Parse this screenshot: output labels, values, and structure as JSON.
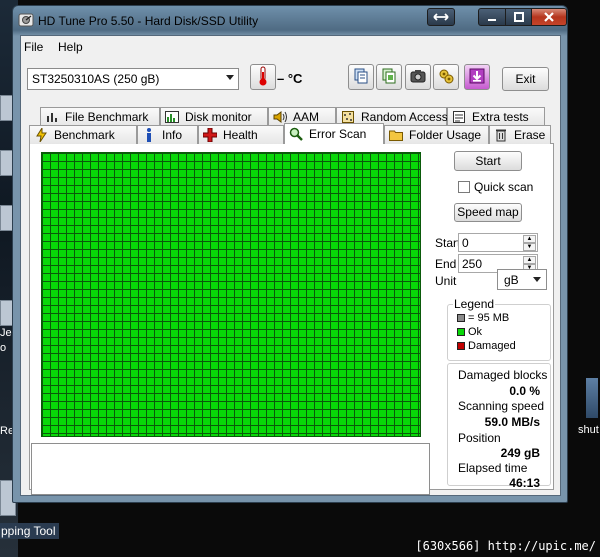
{
  "window": {
    "title": "HD Tune Pro 5.50 - Hard Disk/SSD Utility"
  },
  "menu": {
    "file": "File",
    "help": "Help"
  },
  "toolbar": {
    "drive": "ST3250310AS (250 gB)",
    "temperature": "– °C",
    "exit_label": "Exit",
    "icons": [
      "copy-info-icon",
      "copy-screenshot-icon",
      "camera-icon",
      "options-icon",
      "save-download-icon"
    ]
  },
  "tabs_row1": [
    "File Benchmark",
    "Disk monitor",
    "AAM",
    "Random Access",
    "Extra tests"
  ],
  "tabs_row2": [
    "Benchmark",
    "Info",
    "Health",
    "Error Scan",
    "Folder Usage",
    "Erase"
  ],
  "active_tab": "Error Scan",
  "error_scan": {
    "start_button": "Start",
    "quick_scan_label": "Quick scan",
    "quick_scan_checked": false,
    "speed_map_button": "Speed map",
    "start_label": "Start",
    "start_value": "0",
    "end_label": "End",
    "end_value": "250",
    "unit_label": "Unit",
    "unit_value": "gB",
    "legend": {
      "title": "Legend",
      "block_size": "= 95 MB",
      "ok": "Ok",
      "damaged": "Damaged"
    },
    "stats": {
      "damaged_blocks_label": "Damaged blocks",
      "damaged_blocks_value": "0.0 %",
      "scanning_speed_label": "Scanning speed",
      "scanning_speed_value": "59.0 MB/s",
      "position_label": "Position",
      "position_value": "249 gB",
      "elapsed_time_label": "Elapsed time",
      "elapsed_time_value": "46:13"
    }
  },
  "colors": {
    "block_ok": "#08d808",
    "block_damaged": "#c00000",
    "block_unit": "#8a8a8a"
  },
  "desktop": {
    "left_fragment_1": "Je",
    "left_fragment_2": "o",
    "left_fragment_3": "Re",
    "snipping_tool_label": "pping Tool",
    "right_label": "shut",
    "watermark": "[630x566] http://upic.me/"
  }
}
